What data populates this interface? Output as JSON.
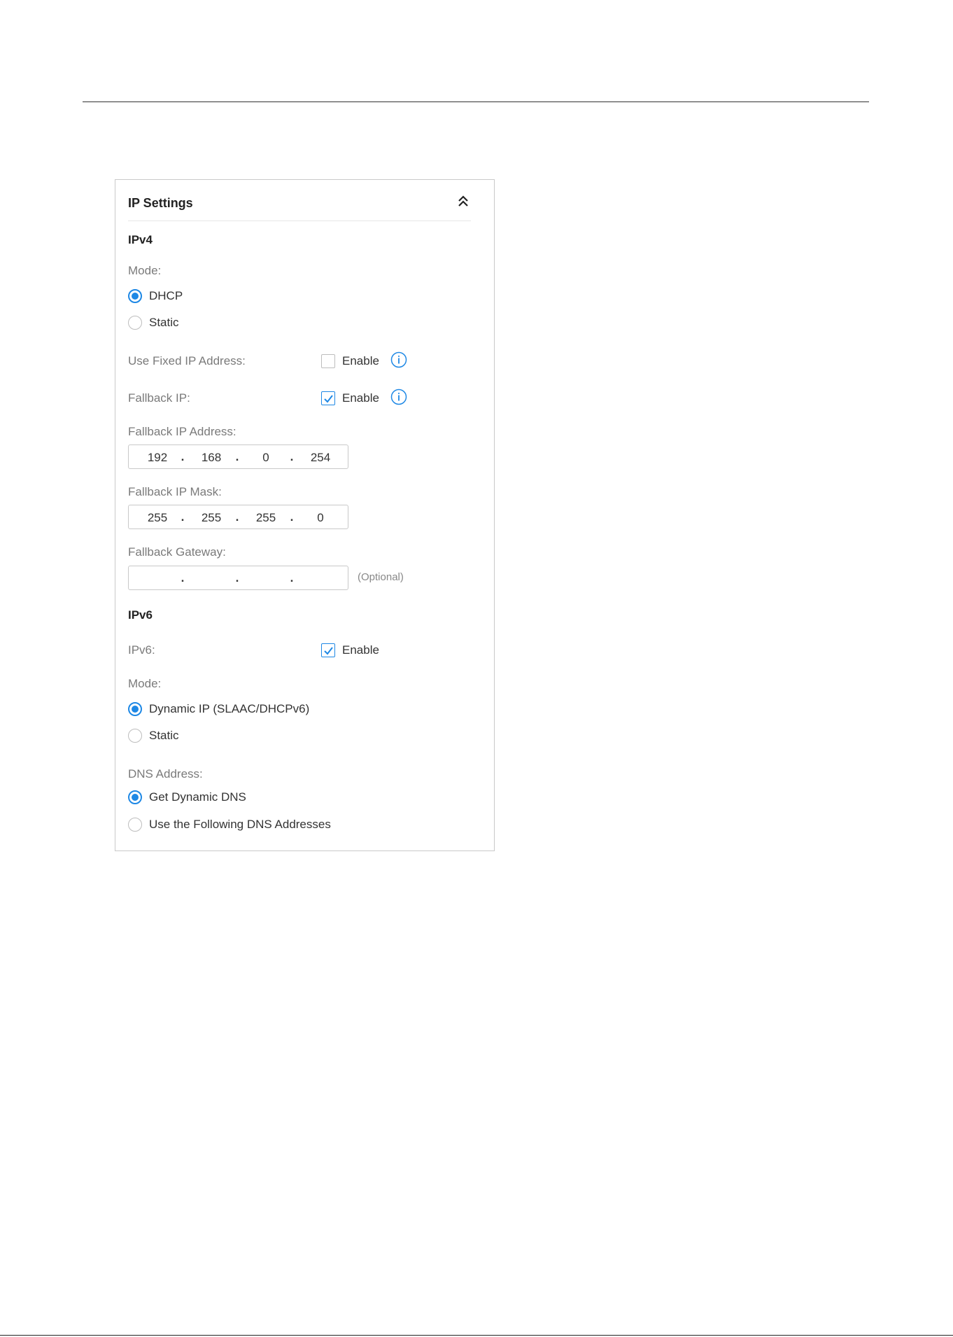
{
  "panel": {
    "title": "IP Settings",
    "collapse_icon": "double-chevron-up-icon"
  },
  "ipv4": {
    "heading": "IPv4",
    "mode_label": "Mode:",
    "mode_options": [
      {
        "label": "DHCP",
        "selected": true
      },
      {
        "label": "Static",
        "selected": false
      }
    ],
    "fixed_ip": {
      "label": "Use Fixed IP Address:",
      "checkbox_label": "Enable",
      "checked": false,
      "icon": "info-icon"
    },
    "fallback_ip": {
      "label": "Fallback IP:",
      "checkbox_label": "Enable",
      "checked": true,
      "icon": "info-icon"
    },
    "fallback_address": {
      "label": "Fallback IP Address:",
      "octets": [
        "192",
        "168",
        "0",
        "254"
      ]
    },
    "fallback_mask": {
      "label": "Fallback IP Mask:",
      "octets": [
        "255",
        "255",
        "255",
        "0"
      ]
    },
    "fallback_gateway": {
      "label": "Fallback Gateway:",
      "octets": [
        "",
        "",
        "",
        ""
      ],
      "note": "(Optional)"
    },
    "separator": "."
  },
  "ipv6": {
    "heading": "IPv6",
    "enable": {
      "label": "IPv6:",
      "checkbox_label": "Enable",
      "checked": true
    },
    "mode_label": "Mode:",
    "mode_options": [
      {
        "label": "Dynamic IP (SLAAC/DHCPv6)",
        "selected": true
      },
      {
        "label": "Static",
        "selected": false
      }
    ],
    "dns_label": "DNS Address:",
    "dns_options": [
      {
        "label": "Get Dynamic DNS",
        "selected": true
      },
      {
        "label": "Use the Following DNS Addresses",
        "selected": false
      }
    ]
  },
  "colors": {
    "accent": "#1e88e5",
    "border": "#c9c9c9",
    "label": "#7a7a7a",
    "text": "#333333"
  }
}
